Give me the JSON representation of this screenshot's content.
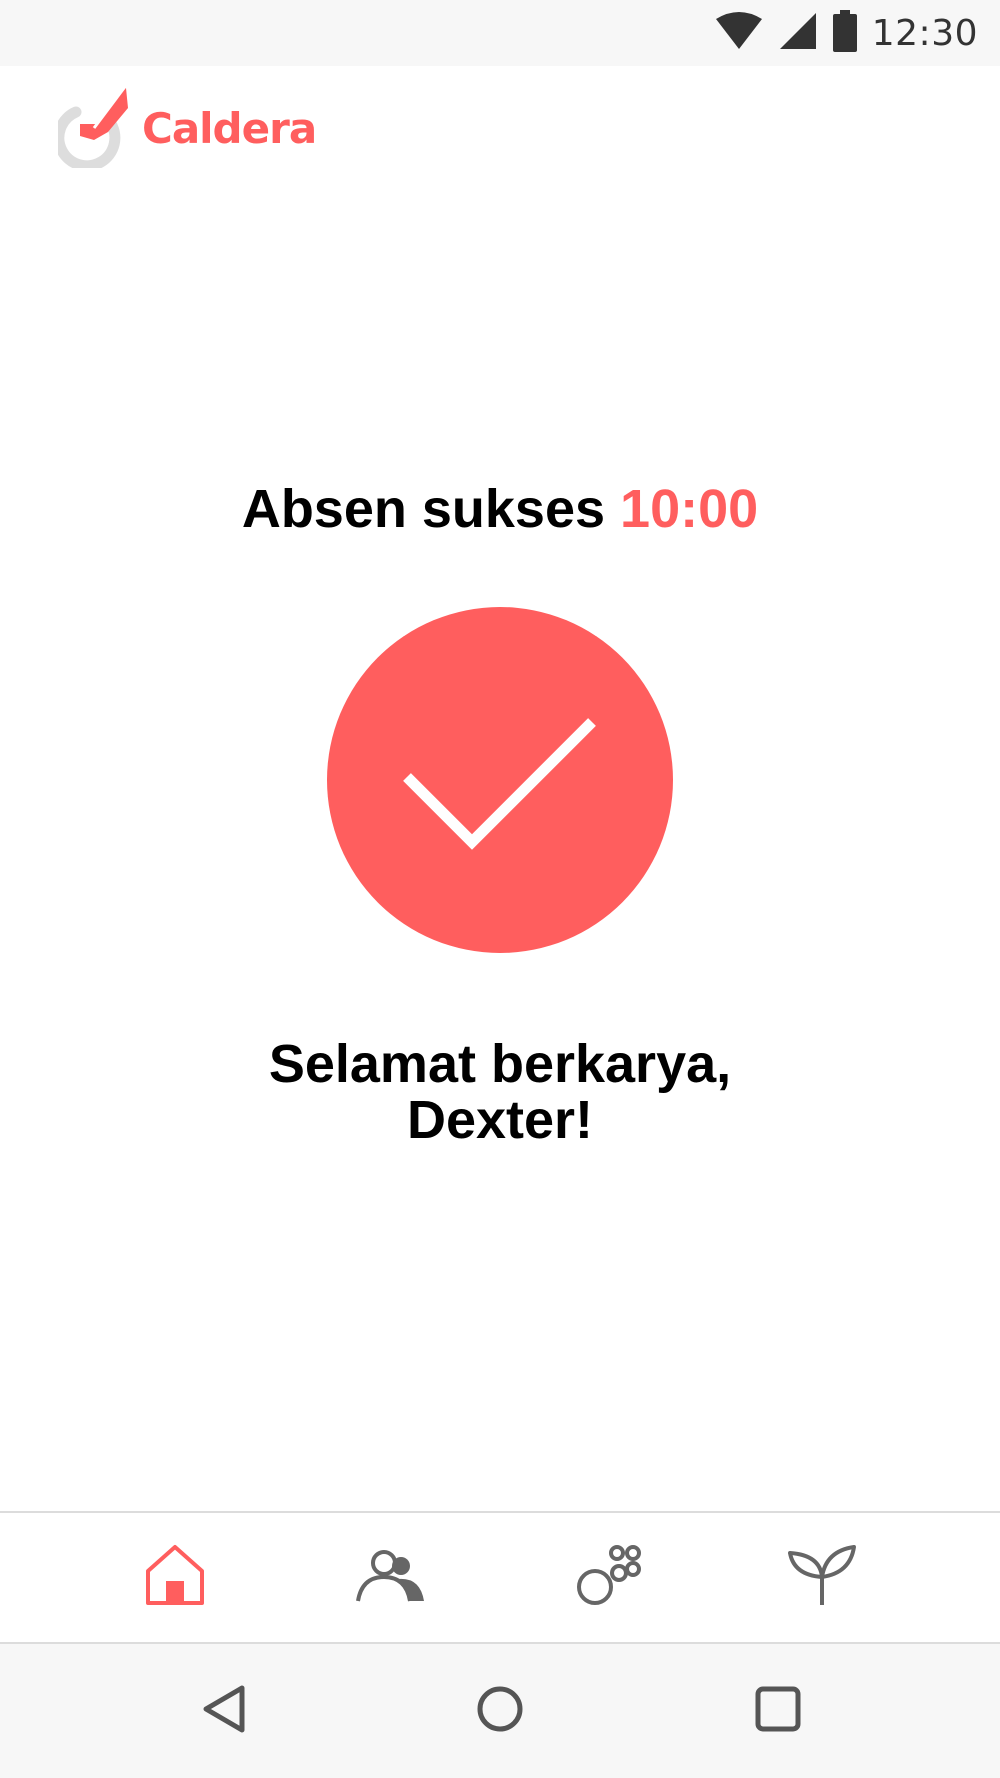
{
  "status_bar": {
    "time": "12:30",
    "icons": [
      "wifi-icon",
      "cell-signal-icon",
      "battery-icon"
    ]
  },
  "app": {
    "name": "Caldera",
    "brand_color": "#ff5e5e"
  },
  "main": {
    "headline_text": "Absen sukses",
    "headline_time": "10:00",
    "greeting_line1": "Selamat berkarya,",
    "greeting_line2": "Dexter!"
  },
  "tabs": [
    {
      "icon": "home-icon",
      "active": true
    },
    {
      "icon": "people-icon",
      "active": false
    },
    {
      "icon": "bubbles-icon",
      "active": false
    },
    {
      "icon": "sprout-icon",
      "active": false
    }
  ],
  "nav": {
    "buttons": [
      "back-icon",
      "home-circle-icon",
      "recents-icon"
    ]
  },
  "colors": {
    "accent": "#ff5e5e",
    "inactive_icon": "#666666",
    "status_icon": "#333333"
  }
}
